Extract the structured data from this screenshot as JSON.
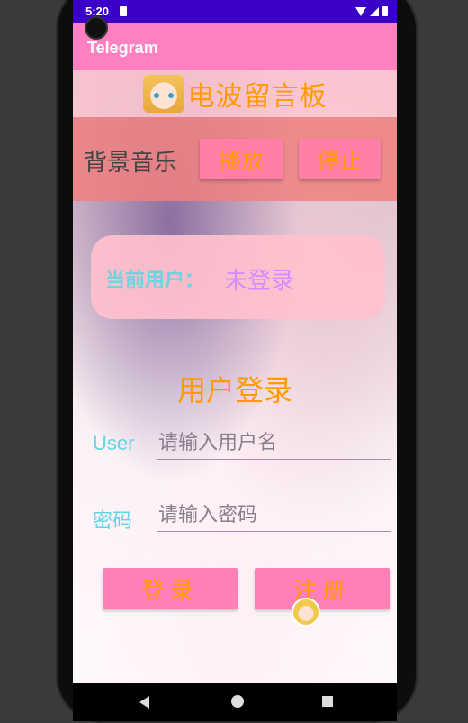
{
  "status_bar": {
    "time": "5:20"
  },
  "app_bar": {
    "title": "Telegram"
  },
  "header": {
    "board_title": "电波留言板"
  },
  "music": {
    "label": "背景音乐",
    "play_button": "播放",
    "stop_button": "停止"
  },
  "user_card": {
    "label": "当前用户：",
    "value": "未登录"
  },
  "login": {
    "title": "用户登录",
    "user_label": "User",
    "user_placeholder": "请输入用户名",
    "password_label": "密码",
    "password_placeholder": "请输入密码",
    "login_button": "登录",
    "register_button": "注册"
  },
  "colors": {
    "status_bar": "#3b00c6",
    "app_bar": "#ff80c0",
    "title_orange": "#ff9a00",
    "label_cyan": "#5fd6e6",
    "value_purple": "#d48bff",
    "button_pink": "#ff7fb8"
  },
  "icons": {
    "status": [
      "sim-card-icon",
      "wifi-icon",
      "signal-icon",
      "battery-icon"
    ],
    "navigation": [
      "back-icon",
      "home-icon",
      "recents-icon"
    ]
  }
}
